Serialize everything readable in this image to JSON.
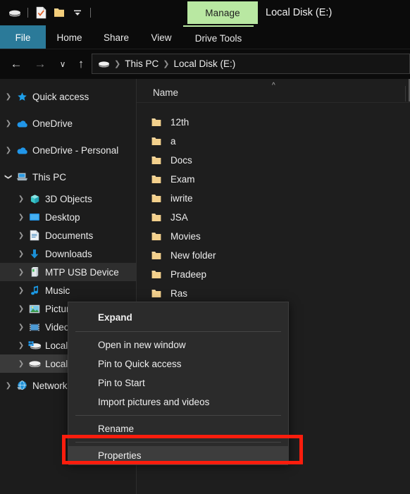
{
  "window": {
    "title": "Local Disk (E:)",
    "contextual_tab": "Manage"
  },
  "quick_access_toolbar": {
    "items": [
      {
        "name": "drive-icon",
        "label": "Drive"
      },
      {
        "name": "properties-icon",
        "label": "Properties"
      },
      {
        "name": "new-folder-icon",
        "label": "New folder"
      },
      {
        "name": "customize-dropdown-icon",
        "label": "Customize Quick Access Toolbar"
      }
    ]
  },
  "ribbon": {
    "tabs": [
      {
        "label": "File",
        "active": true
      },
      {
        "label": "Home",
        "active": false
      },
      {
        "label": "Share",
        "active": false
      },
      {
        "label": "View",
        "active": false
      },
      {
        "label": "Drive Tools",
        "active": false,
        "contextual": true
      }
    ]
  },
  "navbar": {
    "back": "←",
    "forward": "→",
    "recent": "∨",
    "up": "↑",
    "breadcrumbs": [
      {
        "label": "This PC"
      },
      {
        "label": "Local Disk (E:)"
      }
    ]
  },
  "nav_pane": {
    "items": [
      {
        "label": "Quick access",
        "icon": "star-icon",
        "indent": 0,
        "expander": "collapsed",
        "state": "normal"
      },
      {
        "label": "OneDrive",
        "icon": "cloud-icon",
        "indent": 0,
        "expander": "collapsed",
        "state": "normal"
      },
      {
        "label": "OneDrive - Personal",
        "icon": "cloud-icon",
        "indent": 0,
        "expander": "collapsed",
        "state": "normal"
      },
      {
        "label": "This PC",
        "icon": "pc-icon",
        "indent": 0,
        "expander": "expanded",
        "state": "normal"
      },
      {
        "label": "3D Objects",
        "icon": "cube-icon",
        "indent": 1,
        "expander": "collapsed",
        "state": "normal"
      },
      {
        "label": "Desktop",
        "icon": "desktop-icon",
        "indent": 1,
        "expander": "collapsed",
        "state": "normal"
      },
      {
        "label": "Documents",
        "icon": "document-icon",
        "indent": 1,
        "expander": "collapsed",
        "state": "normal"
      },
      {
        "label": "Downloads",
        "icon": "download-icon",
        "indent": 1,
        "expander": "collapsed",
        "state": "normal"
      },
      {
        "label": "MTP USB Device",
        "icon": "usb-device-icon",
        "indent": 1,
        "expander": "collapsed",
        "state": "hover"
      },
      {
        "label": "Music",
        "icon": "music-icon",
        "indent": 1,
        "expander": "collapsed",
        "state": "normal"
      },
      {
        "label": "Pictures",
        "icon": "picture-icon",
        "indent": 1,
        "expander": "collapsed",
        "state": "normal"
      },
      {
        "label": "Videos",
        "icon": "video-icon",
        "indent": 1,
        "expander": "collapsed",
        "state": "normal"
      },
      {
        "label": "Local Disk (C:)",
        "icon": "system-disk-icon",
        "indent": 1,
        "expander": "collapsed",
        "state": "normal"
      },
      {
        "label": "Local Disk (E:)",
        "icon": "disk-icon",
        "indent": 1,
        "expander": "collapsed",
        "state": "selected"
      },
      {
        "label": "Network",
        "icon": "network-icon",
        "indent": 0,
        "expander": "collapsed",
        "state": "normal"
      }
    ]
  },
  "file_list": {
    "column_header": "Name",
    "sort_direction": "ascending",
    "rows": [
      {
        "name": "12th",
        "icon": "folder-icon"
      },
      {
        "name": "a",
        "icon": "folder-icon"
      },
      {
        "name": "Docs",
        "icon": "folder-icon"
      },
      {
        "name": "Exam",
        "icon": "folder-icon"
      },
      {
        "name": "iwrite",
        "icon": "folder-icon"
      },
      {
        "name": "JSA",
        "icon": "folder-icon"
      },
      {
        "name": "Movies",
        "icon": "folder-icon"
      },
      {
        "name": "New folder",
        "icon": "folder-icon"
      },
      {
        "name": "Pradeep",
        "icon": "folder-icon"
      },
      {
        "name": "Ras",
        "icon": "folder-icon"
      }
    ]
  },
  "context_menu": {
    "items": [
      {
        "label": "Expand",
        "bold": true,
        "selected": false,
        "separator_after": true
      },
      {
        "label": "Open in new window",
        "bold": false,
        "selected": false,
        "separator_after": false
      },
      {
        "label": "Pin to Quick access",
        "bold": false,
        "selected": false,
        "separator_after": false
      },
      {
        "label": "Pin to Start",
        "bold": false,
        "selected": false,
        "separator_after": false
      },
      {
        "label": "Import pictures and videos",
        "bold": false,
        "selected": false,
        "separator_after": true
      },
      {
        "label": "Rename",
        "bold": false,
        "selected": false,
        "separator_after": true
      },
      {
        "label": "Properties",
        "bold": false,
        "selected": true,
        "separator_after": false
      }
    ]
  },
  "annotation": {
    "target": "Properties",
    "color": "#fb1d0d"
  },
  "colors": {
    "window_background": "#0b0b0b",
    "nav_pane_background": "#1c1c1c",
    "content_background": "#1e1e1e",
    "file_tab_accent": "#2b7a99",
    "contextual_tab_accent": "#b9e8a2",
    "folder_icon": "#f5d190",
    "highlight_red": "#fb1d0d"
  }
}
